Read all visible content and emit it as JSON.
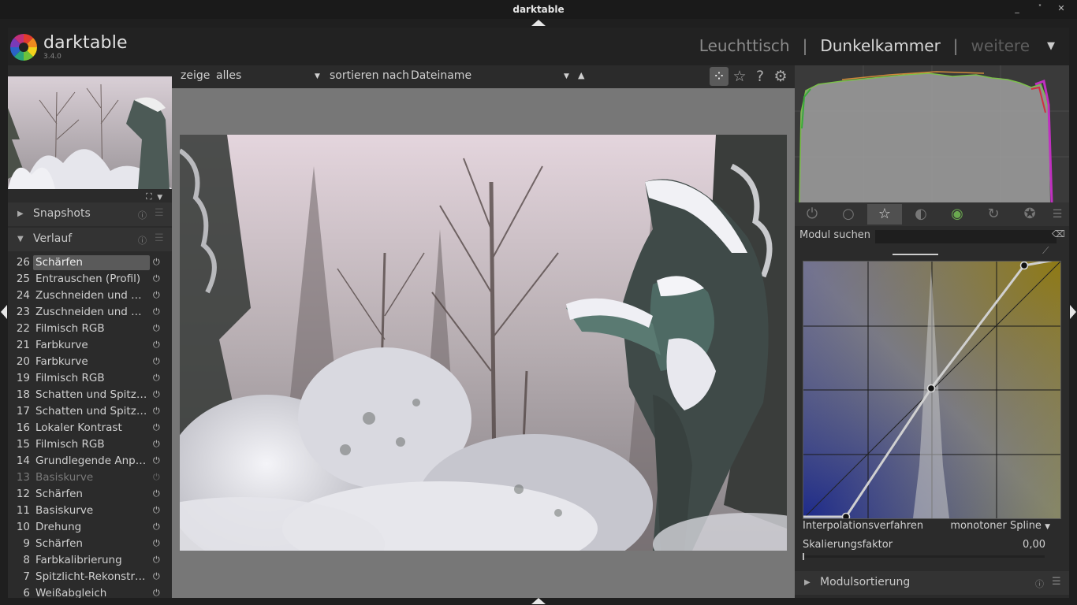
{
  "window": {
    "title": "darktable",
    "controls": [
      "_",
      "˟",
      "✕"
    ]
  },
  "header": {
    "brand": "darktable",
    "version": "3.4.0",
    "views": [
      {
        "label": "Leuchttisch",
        "state": "normal"
      },
      {
        "label": "Dunkelkammer",
        "state": "active"
      },
      {
        "label": "weitere",
        "state": "dim"
      }
    ],
    "separator": "|",
    "more_caret": "▼"
  },
  "left": {
    "snapshots": {
      "label": "Snapshots",
      "arrow": "▶"
    },
    "history_section": {
      "label": "Verlauf",
      "arrow": "▼"
    },
    "history": [
      {
        "num": "26",
        "name": "Schärfen",
        "selected": true,
        "enabled": true
      },
      {
        "num": "25",
        "name": "Entrauschen (Profil)",
        "enabled": true
      },
      {
        "num": "24",
        "name": "Zuschneiden und Drehen",
        "enabled": true
      },
      {
        "num": "23",
        "name": "Zuschneiden und Drehen",
        "enabled": true
      },
      {
        "num": "22",
        "name": "Filmisch RGB",
        "enabled": true
      },
      {
        "num": "21",
        "name": "Farbkurve",
        "enabled": true
      },
      {
        "num": "20",
        "name": "Farbkurve",
        "enabled": true
      },
      {
        "num": "19",
        "name": "Filmisch RGB",
        "enabled": true
      },
      {
        "num": "18",
        "name": "Schatten und Spitzlichter",
        "enabled": true
      },
      {
        "num": "17",
        "name": "Schatten und Spitzlichter",
        "enabled": true
      },
      {
        "num": "16",
        "name": "Lokaler Kontrast",
        "enabled": true
      },
      {
        "num": "15",
        "name": "Filmisch RGB",
        "enabled": true
      },
      {
        "num": "14",
        "name": "Grundlegende Anpassungen",
        "enabled": true
      },
      {
        "num": "13",
        "name": "Basiskurve",
        "enabled": false
      },
      {
        "num": "12",
        "name": "Schärfen",
        "enabled": true
      },
      {
        "num": "11",
        "name": "Basiskurve",
        "enabled": true
      },
      {
        "num": "10",
        "name": "Drehung",
        "enabled": true
      },
      {
        "num": "9",
        "name": "Schärfen",
        "enabled": true
      },
      {
        "num": "8",
        "name": "Farbkalibrierung",
        "enabled": true
      },
      {
        "num": "7",
        "name": "Spitzlicht-Rekonstruktion",
        "enabled": true
      },
      {
        "num": "6",
        "name": "Weißabgleich",
        "enabled": true
      }
    ]
  },
  "filterbar": {
    "show_label": "zeige",
    "show_value": "alles",
    "sort_label": "sortieren nach",
    "sort_value": "Dateiname",
    "sort_dir": "▲",
    "caret": "▼",
    "icons": [
      "grouping-icon",
      "star-icon",
      "help-icon",
      "gear-icon"
    ]
  },
  "right": {
    "module_groups": [
      "power-icon",
      "circle-icon",
      "star-icon",
      "gradient-icon",
      "color-icon",
      "correct-icon",
      "effect-icon",
      "menu-icon"
    ],
    "active_group": 2,
    "search_label": "Modul suchen",
    "search_value": "",
    "interpolation_label": "Interpolationsverfahren",
    "interpolation_value": "monotoner Spline",
    "scale_label": "Skalierungsfaktor",
    "scale_value": "0,00",
    "module_order_label": "Modulsortierung"
  }
}
